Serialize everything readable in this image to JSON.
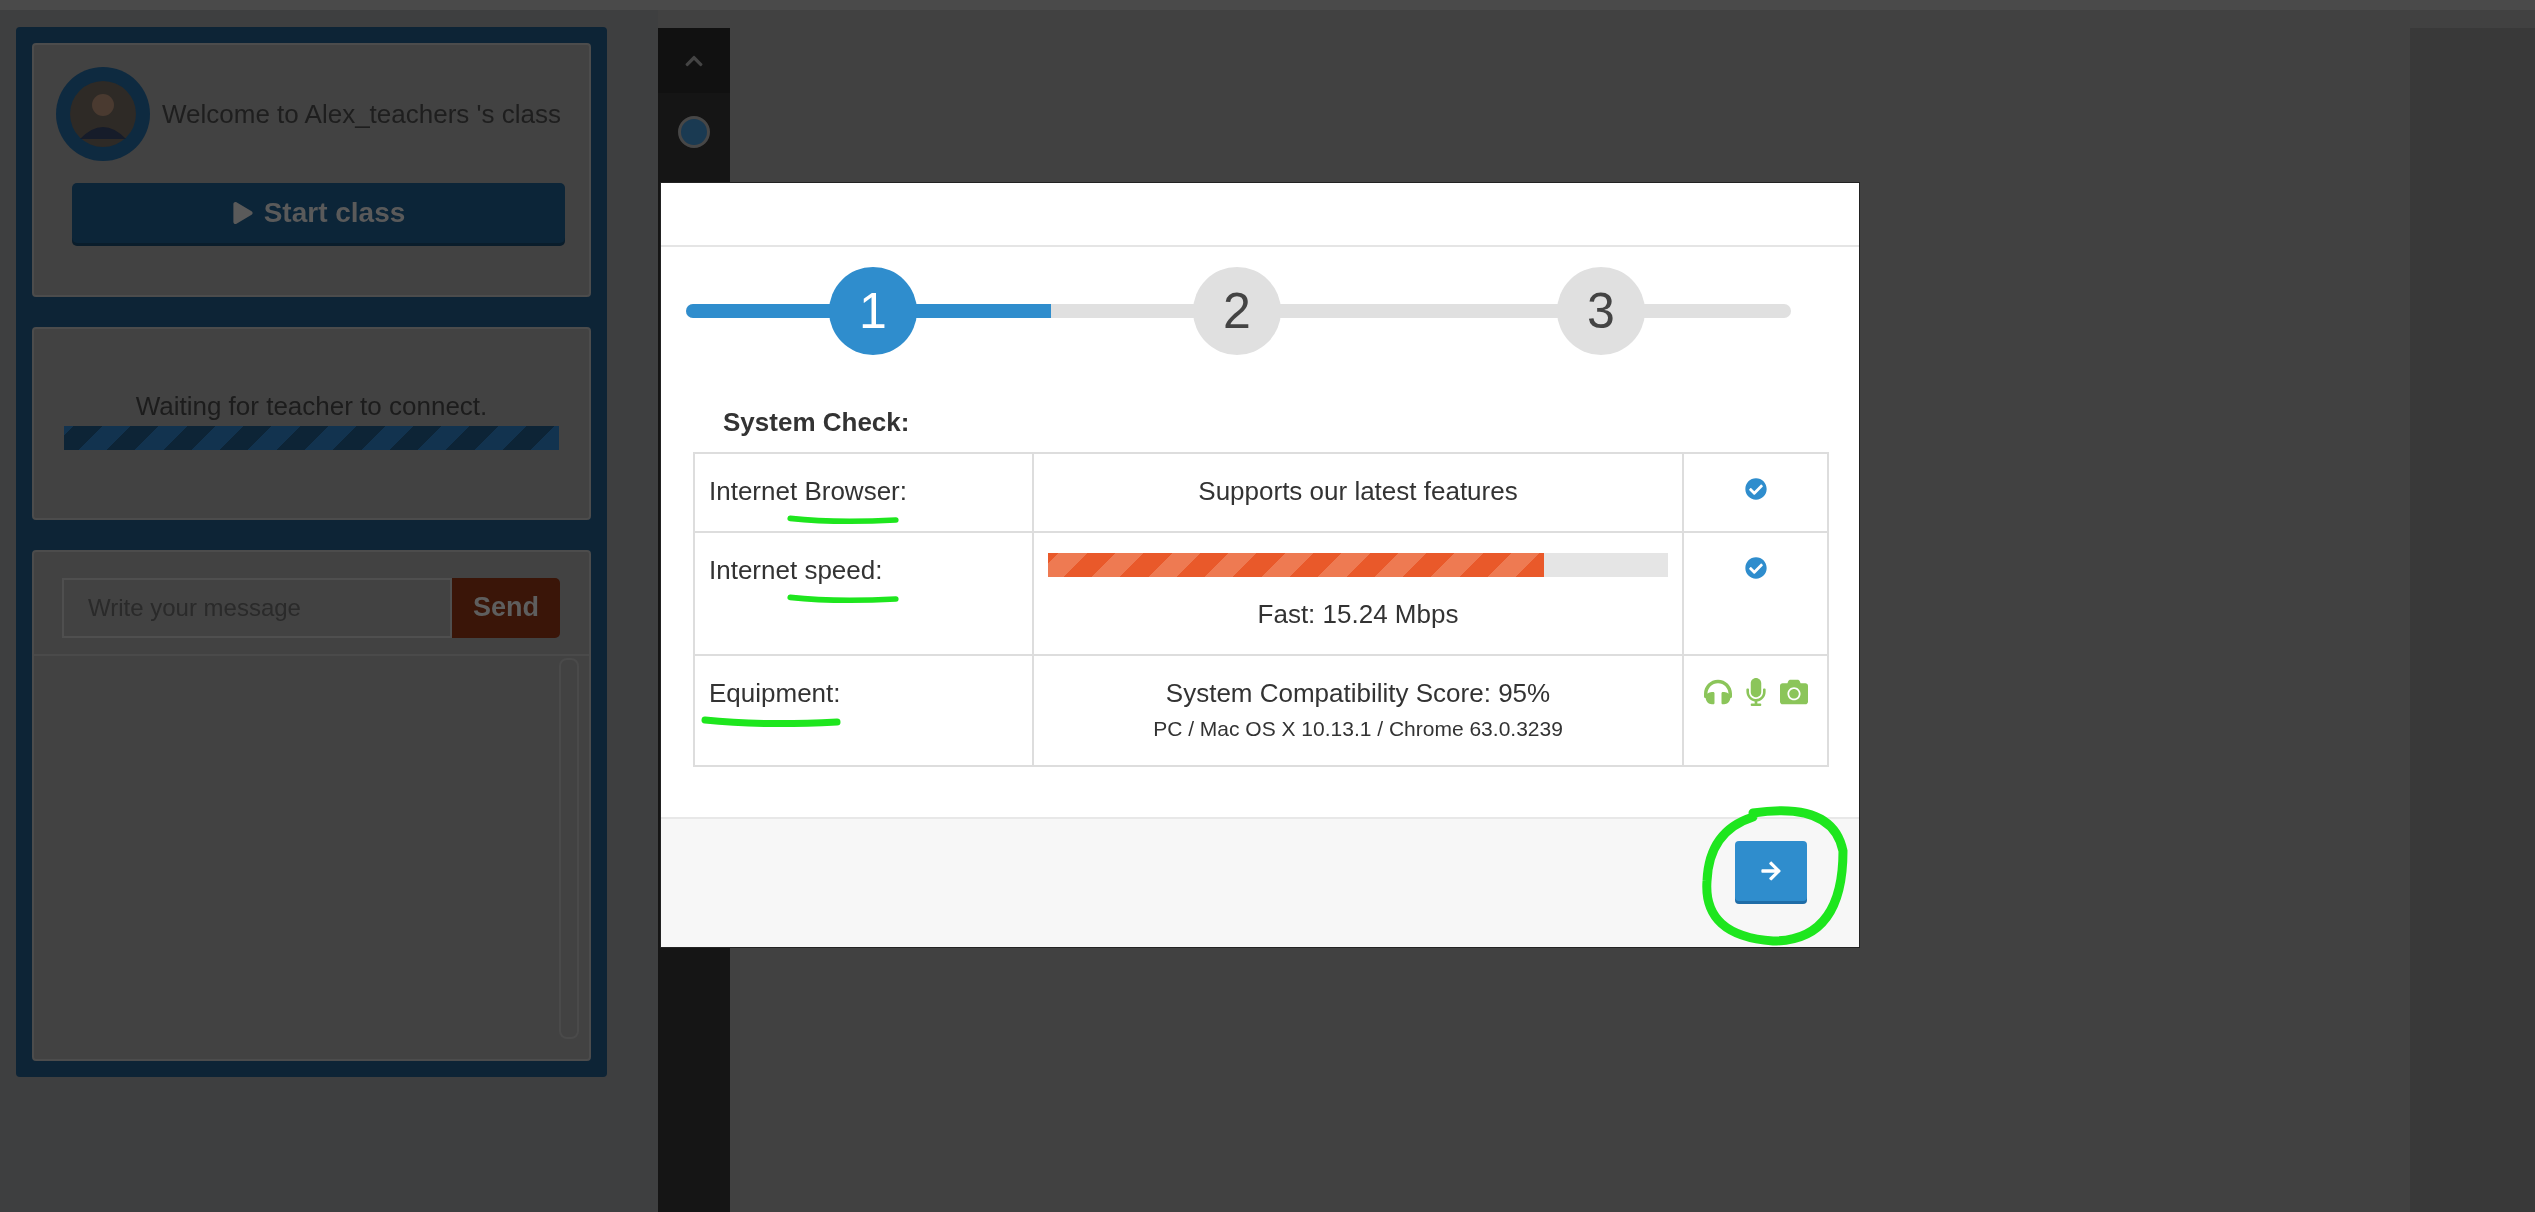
{
  "class_card": {
    "welcome": "Welcome to Alex_teachers 's class",
    "start_button": "Start class"
  },
  "status_card": {
    "message": "Waiting for teacher to connect."
  },
  "chat": {
    "placeholder": "Write your message",
    "send_button": "Send"
  },
  "modal": {
    "steps": [
      {
        "label": "1",
        "selected": true
      },
      {
        "label": "2",
        "selected": false
      },
      {
        "label": "3",
        "selected": false
      }
    ],
    "progress": {
      "level": 0.33
    },
    "title": "System Check:",
    "rows": [
      {
        "kind": "text",
        "label": "Internet Browser:",
        "result": "Supports our latest features",
        "checked": true,
        "highlighted": true
      },
      {
        "kind": "meter",
        "label": "Internet speed:",
        "level": 0.8,
        "result": "Fast: 15.24 Mbps",
        "checked": true,
        "highlighted": true
      },
      {
        "kind": "equipment",
        "label": "Equipment:",
        "result": "System Compatibility Score: 95%",
        "detail": "PC / Mac OS X 10.13.1 / Chrome 63.0.3239",
        "highlighted": true
      }
    ],
    "next_button": {
      "circled": true
    }
  }
}
